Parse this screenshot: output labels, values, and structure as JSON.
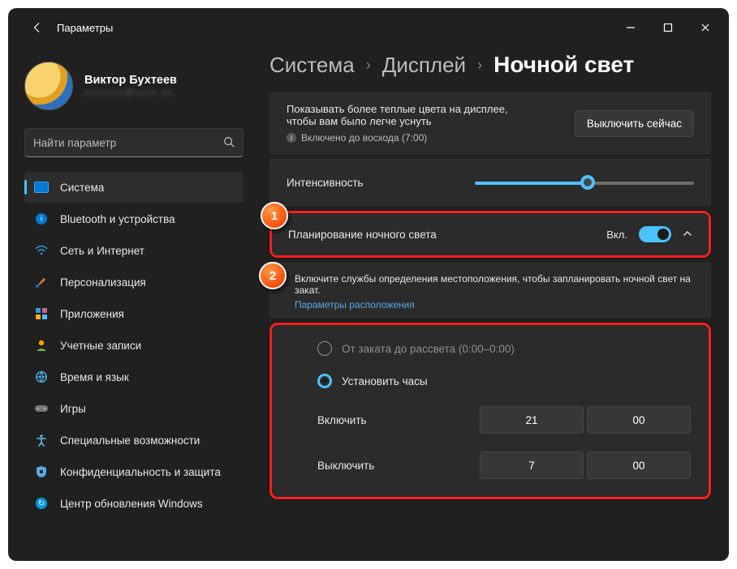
{
  "window": {
    "title": "Параметры"
  },
  "profile": {
    "name": "Виктор Бухтеев",
    "email": "xxxxxxx@xxxx.xx"
  },
  "search": {
    "placeholder": "Найти параметр"
  },
  "sidebar": {
    "items": [
      {
        "label": "Система",
        "selected": true
      },
      {
        "label": "Bluetooth и устройства"
      },
      {
        "label": "Сеть и Интернет"
      },
      {
        "label": "Персонализация"
      },
      {
        "label": "Приложения"
      },
      {
        "label": "Учетные записи"
      },
      {
        "label": "Время и язык"
      },
      {
        "label": "Игры"
      },
      {
        "label": "Специальные возможности"
      },
      {
        "label": "Конфиденциальность и защита"
      },
      {
        "label": "Центр обновления Windows"
      }
    ]
  },
  "breadcrumb": {
    "a": "Система",
    "b": "Дисплей",
    "c": "Ночной свет"
  },
  "info": {
    "text1": "Показывать более теплые цвета на дисплее,",
    "text2": "чтобы вам было легче уснуть",
    "sub": "Включено до восхода (7:00)",
    "action": "Выключить сейчас"
  },
  "intensity": {
    "label": "Интенсивность"
  },
  "schedule": {
    "label": "Планирование ночного света",
    "state": "Вкл."
  },
  "notice": {
    "text": "Включите службы определения местоположения, чтобы запланировать ночной свет на закат.",
    "link": "Параметры расположения"
  },
  "options": {
    "sunset": "От заката до рассвета (0:00–0:00)",
    "sethours": "Установить часы",
    "on_label": "Включить",
    "on_h": "21",
    "on_m": "00",
    "off_label": "Выключить",
    "off_h": "7",
    "off_m": "00"
  },
  "annotations": {
    "one": "1",
    "two": "2"
  }
}
